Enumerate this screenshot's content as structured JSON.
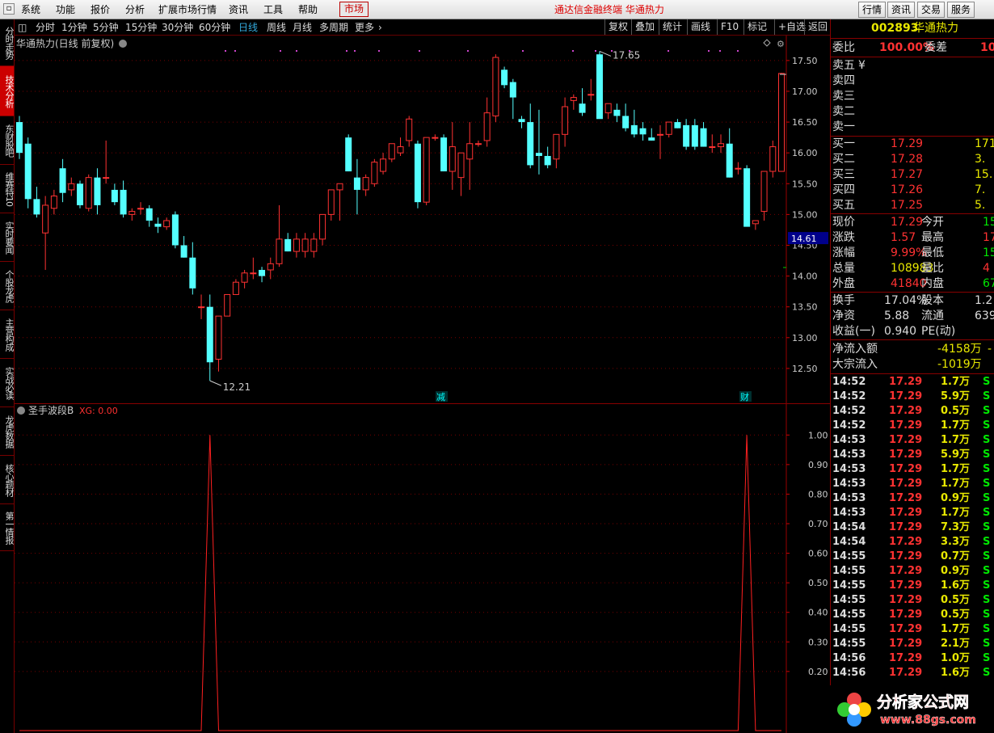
{
  "menu": {
    "items": [
      "系统",
      "功能",
      "报价",
      "分析",
      "扩展市场行情",
      "资讯",
      "工具",
      "帮助"
    ],
    "market": "市场",
    "center_title": "通达信金融终端",
    "center_stock": "华通热力",
    "right_buttons": [
      "行情",
      "资讯",
      "交易",
      "服务"
    ]
  },
  "sidebar": {
    "tabs": [
      "分时走势",
      "技术分析",
      "东财股吧",
      "维赛特10",
      "实时要闻",
      "个股龙虎",
      "主营构成",
      "实战必读",
      "龙虎数据",
      "核心题材",
      "第一情报"
    ],
    "active_index": 1
  },
  "periodbar": {
    "periods": [
      "分时",
      "1分钟",
      "5分钟",
      "15分钟",
      "30分钟",
      "60分钟",
      "日线",
      "周线",
      "月线",
      "多周期",
      "更多"
    ],
    "selected": "日线",
    "tools": [
      "复权",
      "叠加",
      "统计",
      "画线",
      "F10",
      "标记",
      "+自选",
      "返回"
    ]
  },
  "main_chart": {
    "title": "华通热力(日线 前复权)",
    "high_label": "17.65",
    "low_label": "12.21",
    "current_price_tag": "14.61",
    "markers": [
      "减",
      "财"
    ],
    "yticks": [
      "17.50",
      "17.00",
      "16.50",
      "16.00",
      "15.50",
      "15.00",
      "14.50",
      "14.00",
      "13.50",
      "13.00",
      "12.50"
    ],
    "colors": {
      "up": "#ff3232",
      "down": "#54ffff"
    }
  },
  "chart_data": [
    {
      "type": "candlestick",
      "ylim": [
        12.0,
        17.8
      ],
      "yticks": [
        12.5,
        13.0,
        13.5,
        14.0,
        14.5,
        15.0,
        15.5,
        16.0,
        16.5,
        17.0,
        17.5
      ],
      "ohlc": [
        [
          16.5,
          16.6,
          15.9,
          16.0
        ],
        [
          16.15,
          16.25,
          15.1,
          15.25
        ],
        [
          15.25,
          15.45,
          14.95,
          15.0
        ],
        [
          14.7,
          15.3,
          14.1,
          15.15
        ],
        [
          15.1,
          15.4,
          15.0,
          15.3
        ],
        [
          15.75,
          15.9,
          15.2,
          15.35
        ],
        [
          15.4,
          15.6,
          15.3,
          15.5
        ],
        [
          15.5,
          15.55,
          15.1,
          15.15
        ],
        [
          15.1,
          15.65,
          15.05,
          15.6
        ],
        [
          15.6,
          15.75,
          15.0,
          15.15
        ],
        [
          15.6,
          16.2,
          15.5,
          15.6
        ],
        [
          15.4,
          15.5,
          15.15,
          15.2
        ],
        [
          15.4,
          15.55,
          14.95,
          15.0
        ],
        [
          15.0,
          15.1,
          14.9,
          15.05
        ],
        [
          15.1,
          15.2,
          15.0,
          15.1
        ],
        [
          15.1,
          15.15,
          14.8,
          14.9
        ],
        [
          14.85,
          14.95,
          14.7,
          14.8
        ],
        [
          14.8,
          14.95,
          14.75,
          14.9
        ],
        [
          15.0,
          15.05,
          14.45,
          14.5
        ],
        [
          14.5,
          14.65,
          14.3,
          14.3
        ],
        [
          14.3,
          14.55,
          13.7,
          13.8
        ],
        [
          13.5,
          13.7,
          13.3,
          13.5
        ],
        [
          13.5,
          13.7,
          12.3,
          12.6
        ],
        [
          12.65,
          13.35,
          12.45,
          13.35
        ],
        [
          13.35,
          13.7,
          13.35,
          13.7
        ],
        [
          13.7,
          13.95,
          13.7,
          13.9
        ],
        [
          13.9,
          14.1,
          13.8,
          14.05
        ],
        [
          14.05,
          14.3,
          13.95,
          14.05
        ],
        [
          14.1,
          14.15,
          13.9,
          14.0
        ],
        [
          14.1,
          14.3,
          13.95,
          14.2
        ],
        [
          14.2,
          15.15,
          14.15,
          14.6
        ],
        [
          14.6,
          14.7,
          14.4,
          14.4
        ],
        [
          14.4,
          14.7,
          14.3,
          14.6
        ],
        [
          14.4,
          14.7,
          14.3,
          14.6
        ],
        [
          14.4,
          14.7,
          14.3,
          14.6
        ],
        [
          14.6,
          15.0,
          14.5,
          15.0
        ],
        [
          15.0,
          15.4,
          14.9,
          15.4
        ],
        [
          15.4,
          15.4,
          14.9,
          15.5
        ],
        [
          16.25,
          16.3,
          15.7,
          15.7
        ],
        [
          15.6,
          15.9,
          15.0,
          15.4
        ],
        [
          15.4,
          15.65,
          15.3,
          15.6
        ],
        [
          15.5,
          15.9,
          15.45,
          15.85
        ],
        [
          15.7,
          16.0,
          15.65,
          15.9
        ],
        [
          15.9,
          16.15,
          15.85,
          16.15
        ],
        [
          16.0,
          16.25,
          15.95,
          16.1
        ],
        [
          16.2,
          16.6,
          16.1,
          16.55
        ],
        [
          16.15,
          16.2,
          15.1,
          15.2
        ],
        [
          15.2,
          15.7,
          15.15,
          16.25
        ],
        [
          16.25,
          16.3,
          16.2,
          16.25
        ],
        [
          16.25,
          16.3,
          15.7,
          15.7
        ],
        [
          15.7,
          16.5,
          15.4,
          16.1
        ],
        [
          15.6,
          15.7,
          15.3,
          16.0
        ],
        [
          15.9,
          16.5,
          15.4,
          16.15
        ],
        [
          16.15,
          16.2,
          16.1,
          16.15
        ],
        [
          16.2,
          16.9,
          16.1,
          16.65
        ],
        [
          16.6,
          17.6,
          16.5,
          17.55
        ],
        [
          17.35,
          17.4,
          17.05,
          17.1
        ],
        [
          17.15,
          17.2,
          16.55,
          16.9
        ],
        [
          16.55,
          16.6,
          16.4,
          16.5
        ],
        [
          16.5,
          16.8,
          15.75,
          15.8
        ],
        [
          16.0,
          16.7,
          15.65,
          15.95
        ],
        [
          15.95,
          16.1,
          15.75,
          15.8
        ],
        [
          15.9,
          16.3,
          15.75,
          16.3
        ],
        [
          16.3,
          16.9,
          16.1,
          16.75
        ],
        [
          16.85,
          16.95,
          16.7,
          16.9
        ],
        [
          16.8,
          17.05,
          16.6,
          16.65
        ],
        [
          16.95,
          17.2,
          16.85,
          16.95
        ],
        [
          17.6,
          17.65,
          16.8,
          16.55
        ],
        [
          16.65,
          16.75,
          16.55,
          16.8
        ],
        [
          16.7,
          16.8,
          16.5,
          16.6
        ],
        [
          16.6,
          16.8,
          16.35,
          16.4
        ],
        [
          16.45,
          16.7,
          16.25,
          16.3
        ],
        [
          16.4,
          16.5,
          16.2,
          16.3
        ],
        [
          16.25,
          16.4,
          16.2,
          16.2
        ],
        [
          16.3,
          16.45,
          15.9,
          16.3
        ],
        [
          16.3,
          16.5,
          16.25,
          16.5
        ],
        [
          16.5,
          16.55,
          16.4,
          16.4
        ],
        [
          16.45,
          16.55,
          16.05,
          16.1
        ],
        [
          16.45,
          16.55,
          16.05,
          16.1
        ],
        [
          16.4,
          16.5,
          16.1,
          16.1
        ],
        [
          16.1,
          16.3,
          16.0,
          16.1
        ],
        [
          16.1,
          16.3,
          16.0,
          16.15
        ],
        [
          16.15,
          16.4,
          15.6,
          15.6
        ],
        [
          15.75,
          15.85,
          15.65,
          15.75
        ],
        [
          15.75,
          15.8,
          14.95,
          14.8
        ],
        [
          14.85,
          14.9,
          14.75,
          14.9
        ],
        [
          15.05,
          15.6,
          14.9,
          15.7
        ],
        [
          15.7,
          16.2,
          15.6,
          16.1
        ],
        [
          15.7,
          17.3,
          15.7,
          17.29
        ]
      ]
    },
    {
      "type": "line",
      "series": [
        {
          "name": "XG",
          "values": [
            0,
            0,
            0,
            0,
            0,
            0,
            0,
            0,
            0,
            0,
            0,
            0,
            0,
            0,
            0,
            0,
            0,
            0,
            0,
            0,
            0,
            0,
            1,
            0,
            0,
            0,
            0,
            0,
            0,
            0,
            0,
            0,
            0,
            0,
            0,
            0,
            0,
            0,
            0,
            0,
            0,
            0,
            0,
            0,
            0,
            0,
            0,
            0,
            0,
            0,
            0,
            0,
            0,
            0,
            0,
            0,
            0,
            0,
            0,
            0,
            0,
            0,
            0,
            0,
            0,
            0,
            0,
            0,
            0,
            0,
            0,
            0,
            0,
            0,
            0,
            0,
            0,
            0,
            0,
            0,
            0,
            0,
            0,
            0,
            1,
            0,
            0,
            0,
            0
          ]
        }
      ],
      "ylim": [
        0,
        1.05
      ],
      "yticks": [
        0.2,
        0.3,
        0.4,
        0.5,
        0.6,
        0.7,
        0.8,
        0.9,
        1.0
      ]
    }
  ],
  "indicator": {
    "title": "圣手波段B",
    "xg_label": "XG: 0.00",
    "yticks": [
      "1.00",
      "0.90",
      "0.80",
      "0.70",
      "0.60",
      "0.50",
      "0.40",
      "0.30",
      "0.20"
    ],
    "spikes": [
      1,
      23,
      84
    ]
  },
  "quote": {
    "code": "002893",
    "name": "华通热力",
    "weibi_label": "委比",
    "weibi": "100.00%",
    "weicha_label": "委差",
    "weicha": "10",
    "sell": [
      {
        "label": "卖五",
        "price": "¥",
        "vol": ""
      },
      {
        "label": "卖四",
        "price": "",
        "vol": ""
      },
      {
        "label": "卖三",
        "price": "",
        "vol": ""
      },
      {
        "label": "卖二",
        "price": "",
        "vol": ""
      },
      {
        "label": "卖一",
        "price": "",
        "vol": ""
      }
    ],
    "buy": [
      {
        "label": "买一",
        "price": "17.29",
        "vol": "171"
      },
      {
        "label": "买二",
        "price": "17.28",
        "vol": "3."
      },
      {
        "label": "买三",
        "price": "17.27",
        "vol": "15."
      },
      {
        "label": "买四",
        "price": "17.26",
        "vol": "7."
      },
      {
        "label": "买五",
        "price": "17.25",
        "vol": "5."
      }
    ],
    "stats": [
      {
        "l1": "现价",
        "v1": "17.29",
        "c1": "red",
        "l2": "今开",
        "v2": "15",
        "c2": "grn"
      },
      {
        "l1": "涨跌",
        "v1": "1.57",
        "c1": "red",
        "l2": "最高",
        "v2": "17",
        "c2": "red"
      },
      {
        "l1": "涨幅",
        "v1": "9.99%",
        "c1": "red",
        "l2": "最低",
        "v2": "15",
        "c2": "grn"
      },
      {
        "l1": "总量",
        "v1": "108983",
        "c1": "yel",
        "l2": "量比",
        "v2": "4",
        "c2": "red"
      },
      {
        "l1": "外盘",
        "v1": "41840",
        "c1": "red",
        "l2": "内盘",
        "v2": "67",
        "c2": "grn"
      }
    ],
    "fund": [
      {
        "l1": "换手",
        "v1": "17.04%",
        "l2": "股本",
        "v2": "1.2"
      },
      {
        "l1": "净资",
        "v1": "5.88",
        "l2": "流通",
        "v2": "639"
      },
      {
        "l1": "收益(一)",
        "v1": "0.940",
        "l2": "PE(动)",
        "v2": ""
      }
    ],
    "flow": [
      {
        "label": "净流入额",
        "value": "-4158万",
        "extra": "-"
      },
      {
        "label": "大宗流入",
        "value": "-1019万",
        "extra": ""
      }
    ],
    "ticks": [
      [
        "14:52",
        "17.29",
        "1.7万",
        "S"
      ],
      [
        "14:52",
        "17.29",
        "5.9万",
        "S"
      ],
      [
        "14:52",
        "17.29",
        "0.5万",
        "S"
      ],
      [
        "14:52",
        "17.29",
        "1.7万",
        "S"
      ],
      [
        "14:53",
        "17.29",
        "1.7万",
        "S"
      ],
      [
        "14:53",
        "17.29",
        "5.9万",
        "S"
      ],
      [
        "14:53",
        "17.29",
        "1.7万",
        "S"
      ],
      [
        "14:53",
        "17.29",
        "1.7万",
        "S"
      ],
      [
        "14:53",
        "17.29",
        "0.9万",
        "S"
      ],
      [
        "14:53",
        "17.29",
        "1.7万",
        "S"
      ],
      [
        "14:54",
        "17.29",
        "7.3万",
        "S"
      ],
      [
        "14:54",
        "17.29",
        "3.3万",
        "S"
      ],
      [
        "14:55",
        "17.29",
        "0.7万",
        "S"
      ],
      [
        "14:55",
        "17.29",
        "0.9万",
        "S"
      ],
      [
        "14:55",
        "17.29",
        "1.6万",
        "S"
      ],
      [
        "14:55",
        "17.29",
        "0.5万",
        "S"
      ],
      [
        "14:55",
        "17.29",
        "0.5万",
        "S"
      ],
      [
        "14:55",
        "17.29",
        "1.7万",
        "S"
      ],
      [
        "14:55",
        "17.29",
        "2.1万",
        "S"
      ],
      [
        "14:56",
        "17.29",
        "1.0万",
        "S"
      ],
      [
        "14:56",
        "17.29",
        "1.6万",
        "S"
      ]
    ]
  },
  "watermark": {
    "text": "分析家公式网",
    "url": "www.88gs.com"
  }
}
